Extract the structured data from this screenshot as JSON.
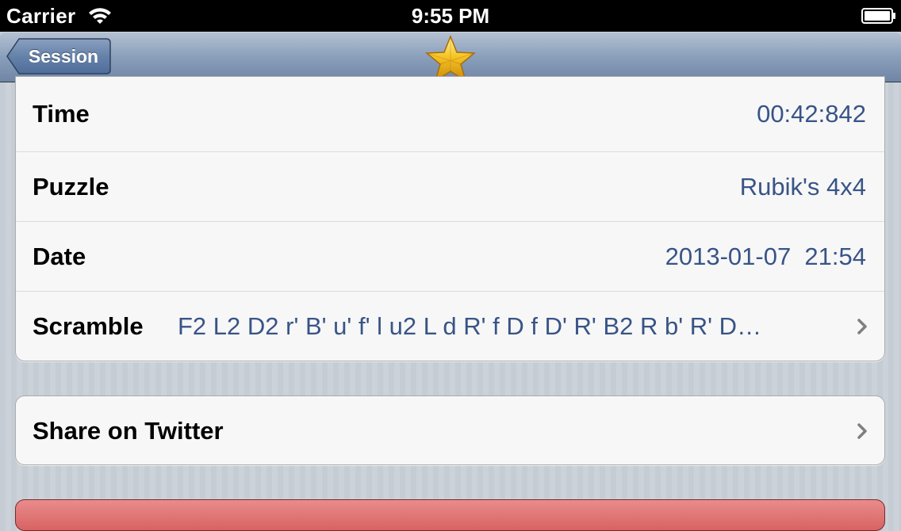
{
  "status_bar": {
    "carrier": "Carrier",
    "time": "9:55 PM",
    "wifi_icon": "wifi-icon",
    "battery_icon": "battery-icon"
  },
  "nav_bar": {
    "back_label": "Session",
    "title_icon": "star-icon",
    "colors": {
      "bar": "#8a9fbb",
      "back_button": "#5f7aa0"
    }
  },
  "details": {
    "rows": [
      {
        "label": "Time",
        "value": "00:42:842"
      },
      {
        "label": "Puzzle",
        "value": "Rubik's 4x4"
      },
      {
        "label": "Date",
        "value": "2013-01-07  21:54"
      },
      {
        "label": "Scramble",
        "value": "F2 L2 D2 r' B' u' f' l u2 L d R' f D f D' R' B2 R b' R' D…",
        "accessory": "chevron-right-icon"
      }
    ]
  },
  "actions": {
    "share_label": "Share on Twitter",
    "share_accessory": "chevron-right-icon"
  },
  "colors": {
    "value_text": "#385487",
    "label_text": "#000000",
    "cell_background": "#f7f7f7",
    "delete_button": "#d86262"
  }
}
